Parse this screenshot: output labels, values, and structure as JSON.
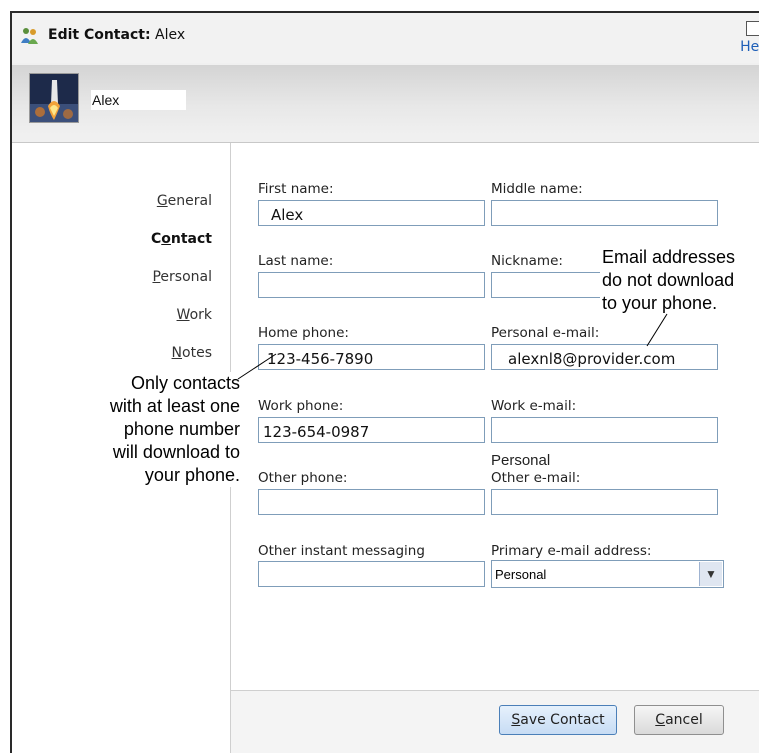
{
  "window": {
    "title_prefix": "Edit Contact:",
    "title_name": "Alex",
    "help_link": "Help"
  },
  "header": {
    "contact_name": "Alex"
  },
  "nav": {
    "items": [
      {
        "label": "General",
        "underline": "G",
        "rest": "eneral",
        "active": false
      },
      {
        "label": "Contact",
        "pre": "C",
        "underline": "o",
        "rest": "ntact",
        "active": true
      },
      {
        "label": "Personal",
        "underline": "P",
        "rest": "ersonal",
        "active": false
      },
      {
        "label": "Work",
        "underline": "W",
        "rest": "ork",
        "active": false
      },
      {
        "label": "Notes",
        "underline": "N",
        "rest": "otes",
        "active": false
      }
    ]
  },
  "form": {
    "first_name": {
      "label": "First name:",
      "value": "Alex"
    },
    "middle_name": {
      "label": "Middle name:",
      "value": ""
    },
    "last_name": {
      "label": "Last name:",
      "value": ""
    },
    "nickname": {
      "label": "Nickname:",
      "value": ""
    },
    "home_phone": {
      "label": "Home phone:",
      "value": "123-456-7890"
    },
    "personal_email": {
      "label": "Personal e-mail:",
      "value": "alexnl8@provider.com"
    },
    "work_phone": {
      "label": "Work phone:",
      "value": "123-654-0987"
    },
    "work_email": {
      "label": "Work e-mail:",
      "value": ""
    },
    "other_phone": {
      "label": "Other phone:",
      "value": ""
    },
    "other_email": {
      "label_line1": "Personal",
      "label_line2": "Other e-mail:",
      "value": ""
    },
    "other_im": {
      "label": "Other instant messaging",
      "value": ""
    },
    "primary_email": {
      "label": "Primary e-mail address:",
      "value": "Personal"
    }
  },
  "buttons": {
    "save": {
      "underline": "S",
      "rest": "ave Contact"
    },
    "cancel": {
      "underline": "C",
      "rest": "ancel"
    }
  },
  "callouts": {
    "phone_note": [
      "Only contacts",
      "with at least one",
      "phone number",
      "will download to",
      "your phone."
    ],
    "email_note": [
      "Email addresses",
      "do not download",
      "to your phone."
    ]
  },
  "colors": {
    "link": "#1e5fb8",
    "input_border": "#7f9db9",
    "primary_button": "#c7dcf4"
  }
}
